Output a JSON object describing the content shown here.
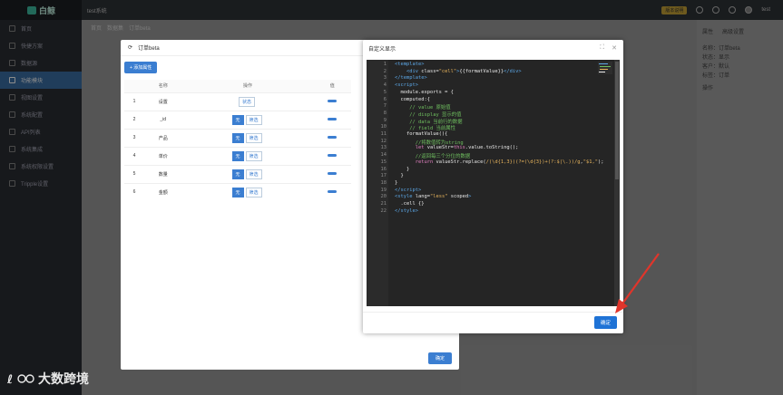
{
  "app": {
    "logo_text": "白鲸",
    "top_title": "test系统",
    "version_badge": "版本说明",
    "user": "test"
  },
  "breadcrumb": [
    "首页",
    "数据集",
    "订单beta"
  ],
  "sidebar": {
    "items": [
      {
        "label": "首页",
        "active": false
      },
      {
        "label": "快捷方案",
        "active": false
      },
      {
        "label": "数据源",
        "active": false
      },
      {
        "label": "功能模块",
        "active": true
      },
      {
        "label": "视图设置",
        "active": false
      },
      {
        "label": "系统配置",
        "active": false
      },
      {
        "label": "API列表",
        "active": false
      },
      {
        "label": "系统集成",
        "active": false
      },
      {
        "label": "系统权限设置",
        "active": false
      },
      {
        "label": "Tripple设置",
        "active": false
      }
    ]
  },
  "right_panel": {
    "tabs": [
      "属性",
      "高级设置"
    ],
    "list": [
      "名称：订单beta",
      "状态：显示",
      "客户：默认",
      "标签：订单"
    ],
    "section": "操作"
  },
  "dialog1": {
    "title": "订单beta",
    "add_button": "+ 添加属性",
    "columns": [
      "",
      "名称",
      "操作",
      "值"
    ],
    "rows": [
      {
        "no": "1",
        "name": "设置",
        "ops": [
          "状态"
        ]
      },
      {
        "no": "2",
        "name": "_id",
        "ops": [
          "无",
          "筛选"
        ]
      },
      {
        "no": "3",
        "name": "产品",
        "ops": [
          "无",
          "筛选"
        ]
      },
      {
        "no": "4",
        "name": "单价",
        "ops": [
          "无",
          "筛选"
        ]
      },
      {
        "no": "5",
        "name": "数量",
        "ops": [
          "无",
          "筛选"
        ]
      },
      {
        "no": "6",
        "name": "金额",
        "ops": [
          "无",
          "筛选"
        ]
      }
    ],
    "ok_button": "确定"
  },
  "dialog2": {
    "title": "自定义显示",
    "max_icon": "⛶",
    "close_icon": "✕",
    "ok_button": "确定",
    "code": [
      {
        "n": "1",
        "html": "<span class='tag'>&lt;template&gt;</span>"
      },
      {
        "n": "2",
        "html": "    <span class='tag'>&lt;div</span> class=<span class='str'>\"cell\"</span><span class='tag'>&gt;</span>{{formatValue}}<span class='tag'>&lt;/div&gt;</span>"
      },
      {
        "n": "3",
        "html": "<span class='tag'>&lt;/template&gt;</span>"
      },
      {
        "n": "4",
        "html": "<span class='tag'>&lt;script&gt;</span>"
      },
      {
        "n": "5",
        "html": "  module.exports = {"
      },
      {
        "n": "6",
        "html": "  computed:{"
      },
      {
        "n": "7",
        "html": "     <span class='cmt'>// value 原始值</span>"
      },
      {
        "n": "8",
        "html": "     <span class='cmt'>// display 显示的值</span>"
      },
      {
        "n": "9",
        "html": "     <span class='cmt'>// data 当前行的数据</span>"
      },
      {
        "n": "10",
        "html": "     <span class='cmt'>// field 当前属性</span>"
      },
      {
        "n": "11",
        "html": "    formatValue(){"
      },
      {
        "n": "12",
        "html": "       <span class='cmt'>//将数值转为string</span>"
      },
      {
        "n": "13",
        "html": "       <span class='kw'>let</span> valueStr=<span class='kw'>this</span>.value.toString();"
      },
      {
        "n": "14",
        "html": "       <span class='cmt'>//返回每三个分位的数据</span>"
      },
      {
        "n": "15",
        "html": "       <span class='kw'>return</span> valueStr.replace(<span class='re'>/(\\d{1,3})(?=(\\d{3})+(?:$|\\.))/g</span>,<span class='str'>\"$1,\"</span>);"
      },
      {
        "n": "16",
        "html": "    }"
      },
      {
        "n": "17",
        "html": "  }"
      },
      {
        "n": "18",
        "html": "}"
      },
      {
        "n": "19",
        "html": "<span class='tag'>&lt;/script&gt;</span>"
      },
      {
        "n": "20",
        "html": "<span class='tag'>&lt;style</span> lang=<span class='str'>\"less\"</span> scoped<span class='tag'>&gt;</span>"
      },
      {
        "n": "21",
        "html": "  .cell {}"
      },
      {
        "n": "22",
        "html": "<span class='tag'>&lt;/style&gt;</span>"
      }
    ]
  },
  "watermark": {
    "text": "大数跨境"
  },
  "colors": {
    "accent": "#1f73d6",
    "arrow": "#e0352b"
  }
}
